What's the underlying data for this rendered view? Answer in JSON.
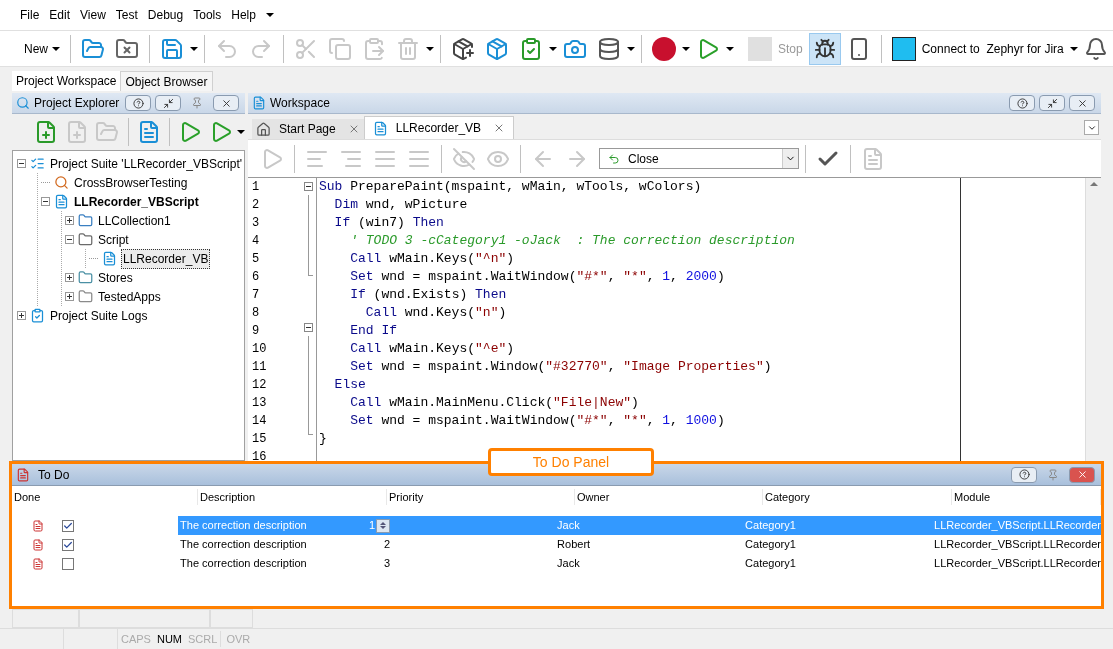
{
  "menu": [
    {
      "label": "File"
    },
    {
      "label": "Edit"
    },
    {
      "label": "View"
    },
    {
      "label": "Test"
    },
    {
      "label": "Debug"
    },
    {
      "label": "Tools"
    },
    {
      "label": "Help"
    }
  ],
  "toolbar": {
    "new_label": "New",
    "stop": {
      "label": "Stop",
      "disabled": true
    },
    "connect_label": "Connect to  Zephyr for Jira"
  },
  "panel_tabs": [
    {
      "label": "Project Workspace",
      "selected": true
    },
    {
      "label": "Object Browser",
      "selected": false
    }
  ],
  "project_explorer": {
    "title": "Project Explorer",
    "tree": [
      {
        "label": "Project Suite 'LLRecorder_VBScript'",
        "kind": "suite",
        "expanded": true,
        "selected": false,
        "children": [
          {
            "label": "CrossBrowserTesting",
            "kind": "browser",
            "selected": false
          },
          {
            "label": "LLRecorder_VBScript",
            "kind": "project",
            "expanded": true,
            "selected": false,
            "children": [
              {
                "label": "LLCollection1",
                "kind": "collection",
                "expanded": false,
                "selected": false
              },
              {
                "label": "Script",
                "kind": "script",
                "expanded": true,
                "selected": false,
                "children": [
                  {
                    "label": "LLRecorder_VB",
                    "kind": "unit",
                    "selected": true
                  }
                ]
              },
              {
                "label": "Stores",
                "kind": "stores",
                "expanded": false,
                "selected": false
              },
              {
                "label": "TestedApps",
                "kind": "apps",
                "expanded": false,
                "selected": false
              }
            ]
          }
        ]
      },
      {
        "label": "Project Suite Logs",
        "kind": "logs",
        "expanded": false,
        "selected": false
      }
    ]
  },
  "workspace": {
    "title": "Workspace",
    "tabs": [
      {
        "label": "Start Page",
        "kind": "home",
        "selected": false
      },
      {
        "label": "LLRecorder_VB",
        "kind": "unit",
        "selected": true
      }
    ],
    "routine_select": {
      "value": "Close"
    },
    "code": [
      {
        "number": "1",
        "kind": "start",
        "tokens": [
          {
            "kind": "keyword",
            "text": "Sub"
          },
          {
            "kind": "plain",
            "text": " PreparePaint(mspaint, wMain, wTools, wColors)"
          }
        ]
      },
      {
        "number": "2",
        "kind": "body",
        "tokens": [
          {
            "kind": "keyword",
            "text": "  Dim"
          },
          {
            "kind": "plain",
            "text": " wnd, wPicture"
          }
        ]
      },
      {
        "number": "3",
        "kind": "body",
        "tokens": [
          {
            "kind": "keyword",
            "text": "  If"
          },
          {
            "kind": "plain",
            "text": " (win7) "
          },
          {
            "kind": "keyword",
            "text": "Then"
          }
        ]
      },
      {
        "number": "4",
        "kind": "body",
        "tokens": [
          {
            "kind": "comment",
            "text": "    ' TODO 3 -cCategory1 -oJack  : The correction description"
          }
        ]
      },
      {
        "number": "5",
        "kind": "body",
        "tokens": [
          {
            "kind": "keyword",
            "text": "    Call"
          },
          {
            "kind": "plain",
            "text": " wMain.Keys("
          },
          {
            "kind": "string",
            "text": "\"^n\""
          },
          {
            "kind": "plain",
            "text": ")"
          }
        ]
      },
      {
        "number": "6",
        "kind": "end",
        "tokens": [
          {
            "kind": "keyword",
            "text": "    Set"
          },
          {
            "kind": "plain",
            "text": " wnd = mspaint.WaitWindow("
          },
          {
            "kind": "string",
            "text": "\"#*\""
          },
          {
            "kind": "plain",
            "text": ", "
          },
          {
            "kind": "string",
            "text": "\"*\""
          },
          {
            "kind": "plain",
            "text": ", "
          },
          {
            "kind": "number",
            "text": "1"
          },
          {
            "kind": "plain",
            "text": ", "
          },
          {
            "kind": "number",
            "text": "2000"
          },
          {
            "kind": "plain",
            "text": ")"
          }
        ]
      },
      {
        "number": "7",
        "kind": "plain",
        "tokens": [
          {
            "kind": "keyword",
            "text": "    If"
          },
          {
            "kind": "plain",
            "text": " (wnd.Exists) "
          },
          {
            "kind": "keyword",
            "text": "Then"
          }
        ]
      },
      {
        "number": "8",
        "kind": "plain",
        "tokens": [
          {
            "kind": "keyword",
            "text": "      Call"
          },
          {
            "kind": "plain",
            "text": " wnd.Keys("
          },
          {
            "kind": "string",
            "text": "\"n\""
          },
          {
            "kind": "plain",
            "text": ")"
          }
        ]
      },
      {
        "number": "9",
        "kind": "start",
        "tokens": [
          {
            "kind": "keyword",
            "text": "    End If"
          }
        ]
      },
      {
        "number": "10",
        "kind": "body",
        "tokens": [
          {
            "kind": "keyword",
            "text": "    Call"
          },
          {
            "kind": "plain",
            "text": " wMain.Keys("
          },
          {
            "kind": "string",
            "text": "\"^e\""
          },
          {
            "kind": "plain",
            "text": ")"
          }
        ]
      },
      {
        "number": "11",
        "kind": "body",
        "tokens": [
          {
            "kind": "keyword",
            "text": "    Set"
          },
          {
            "kind": "plain",
            "text": " wnd = mspaint.Window("
          },
          {
            "kind": "string",
            "text": "\"#32770\""
          },
          {
            "kind": "plain",
            "text": ", "
          },
          {
            "kind": "string",
            "text": "\"Image Properties\""
          },
          {
            "kind": "plain",
            "text": ")"
          }
        ]
      },
      {
        "number": "12",
        "kind": "body",
        "tokens": [
          {
            "kind": "keyword",
            "text": "  Else"
          }
        ]
      },
      {
        "number": "13",
        "kind": "body",
        "tokens": [
          {
            "kind": "keyword",
            "text": "    Call"
          },
          {
            "kind": "plain",
            "text": " wMain.MainMenu.Click("
          },
          {
            "kind": "string",
            "text": "\"File|New\""
          },
          {
            "kind": "plain",
            "text": ")"
          }
        ]
      },
      {
        "number": "14",
        "kind": "body",
        "tokens": [
          {
            "kind": "keyword",
            "text": "    Set"
          },
          {
            "kind": "plain",
            "text": " wnd = mspaint.WaitWindow("
          },
          {
            "kind": "string",
            "text": "\"#*\""
          },
          {
            "kind": "plain",
            "text": ", "
          },
          {
            "kind": "string",
            "text": "\"*\""
          },
          {
            "kind": "plain",
            "text": ", "
          },
          {
            "kind": "number",
            "text": "1"
          },
          {
            "kind": "plain",
            "text": ", "
          },
          {
            "kind": "number",
            "text": "1000"
          },
          {
            "kind": "plain",
            "text": ")"
          }
        ]
      },
      {
        "number": "15",
        "kind": "end",
        "tokens": [
          {
            "kind": "plain",
            "text": "}"
          }
        ]
      },
      {
        "number": "16",
        "kind": "plain"
      }
    ]
  },
  "todo": {
    "title": "To Do",
    "callout": "To Do Panel",
    "columns": [
      "Done",
      "Description",
      "Priority",
      "Owner",
      "Category",
      "Module"
    ],
    "rows": [
      {
        "done": true,
        "description": "The correction description",
        "priority": "1",
        "owner": "Jack",
        "category": "Category1",
        "module": "LLRecorder_VBScript.LLRecorder",
        "selected": true
      },
      {
        "done": true,
        "description": "The correction description",
        "priority": "2",
        "owner": "Robert",
        "category": "Category1",
        "module": "LLRecorder_VBScript.LLRecorder",
        "selected": false
      },
      {
        "done": false,
        "description": "The correction description",
        "priority": "3",
        "owner": "Jack",
        "category": "Category1",
        "module": "LLRecorder_VBScript.LLRecorder",
        "selected": false
      }
    ]
  },
  "status_bar": {
    "indicators": [
      {
        "label": "CAPS",
        "on": false
      },
      {
        "label": "NUM",
        "on": true
      },
      {
        "label": "SCRL",
        "on": false
      },
      {
        "label": "OVR",
        "on": false
      }
    ]
  }
}
